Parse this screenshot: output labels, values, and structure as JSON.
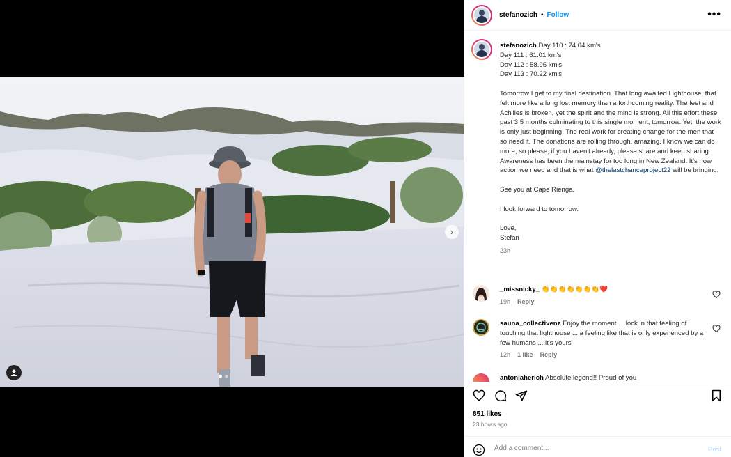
{
  "post": {
    "username": "stefanozich",
    "separator": "•",
    "follow_label": "Follow",
    "more_label": "•••"
  },
  "caption": {
    "username": "stefanozich",
    "line1": "Day 110 : 74.04 km's",
    "line2": "Day 111 : 61.01 km's",
    "line3": "Day 112 : 58.95 km's",
    "line4": "Day 113 : 70.22 km's",
    "para1": "Tomorrow I get to my final destination. That long awaited Lighthouse, that felt more like a long lost memory than a forthcoming reality. The feet and Achilles is broken, yet the spirit and the mind is strong. All this effort these past 3.5 months culminating to this single moment, tomorrow. Yet, the work is only just beginning. The real work for creating change for the men that so need it. The donations are rolling through, amazing. I know we can do more, so please, if you haven't already, please share and keep sharing. Awareness has been the mainstay for too long in New Zealand. It's now action we need and that is what",
    "mention": "@thelastchanceproject22",
    "para1_end": "will be bringing.",
    "para2": "See you at Cape Rienga.",
    "para3": "I look forward to tomorrow.",
    "signoff1": "Love,",
    "signoff2": "Stefan",
    "time": "23h"
  },
  "comments": [
    {
      "username": "_missnicky_",
      "text": "👏👏👏👏👏👏👏❤️",
      "time": "19h",
      "reply": "Reply"
    },
    {
      "username": "sauna_collectivenz",
      "text": "Enjoy the moment ... lock in that feeling of touching that lighthouse ... a feeling like that is only experienced by a few humans ... it's yours",
      "time": "12h",
      "likes": "1 like",
      "reply": "Reply"
    },
    {
      "username": "antoniaherich",
      "text": "Absolute legend!! Proud of you"
    }
  ],
  "stats": {
    "likes": "851 likes",
    "ago": "23 hours ago"
  },
  "composer": {
    "placeholder": "Add a comment...",
    "post_label": "Post"
  },
  "colors": {
    "link": "#0095f6",
    "mention": "#00376b",
    "meta": "#737373"
  }
}
